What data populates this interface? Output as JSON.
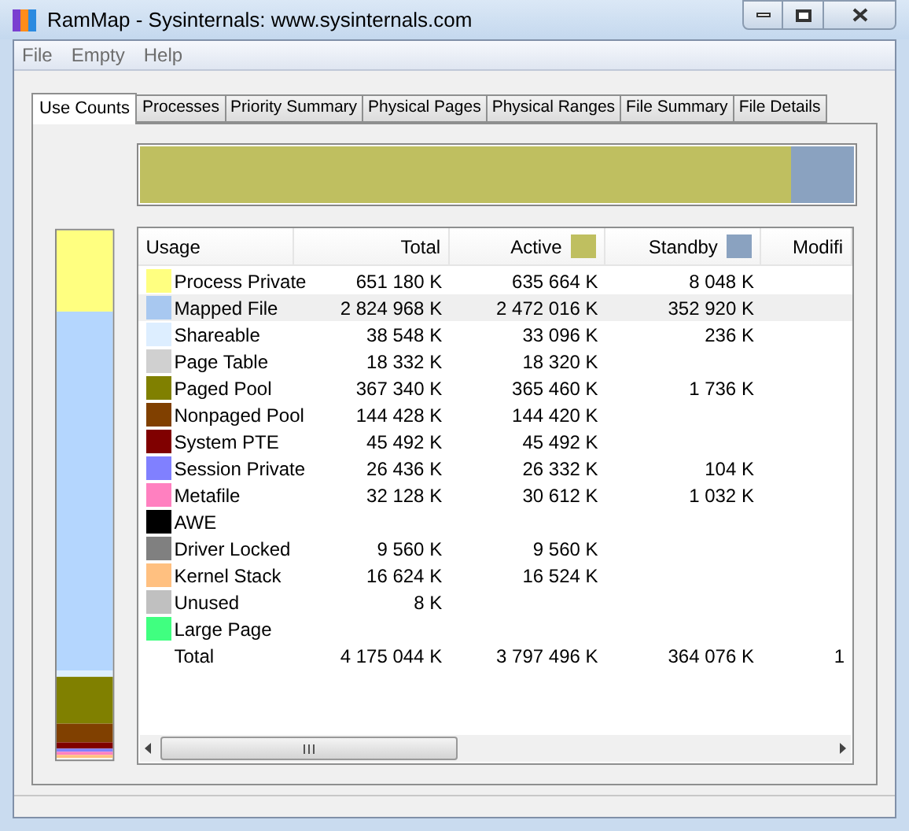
{
  "window": {
    "title": "RamMap - Sysinternals: www.sysinternals.com"
  },
  "menu": [
    "File",
    "Empty",
    "Help"
  ],
  "tabs": [
    {
      "label": "Use Counts",
      "selected": true
    },
    {
      "label": "Processes",
      "selected": false
    },
    {
      "label": "Priority Summary",
      "selected": false
    },
    {
      "label": "Physical Pages",
      "selected": false
    },
    {
      "label": "Physical Ranges",
      "selected": false
    },
    {
      "label": "File Summary",
      "selected": false
    },
    {
      "label": "File Details",
      "selected": false
    }
  ],
  "table": {
    "columns": [
      {
        "label": "Usage"
      },
      {
        "label": "Total"
      },
      {
        "label": "Active",
        "color": "#bfbf60"
      },
      {
        "label": "Standby",
        "color": "#8aa2c0"
      },
      {
        "label": "Modifi"
      }
    ],
    "rows": [
      {
        "kind": "usage",
        "color": "#ffff80",
        "selected": false,
        "cells": [
          "Process Private",
          "651 180 K",
          "635 664 K",
          "8 048 K",
          ""
        ]
      },
      {
        "kind": "usage",
        "color": "#a8c8f0",
        "selected": true,
        "cells": [
          "Mapped File",
          "2 824 968 K",
          "2 472 016 K",
          "352 920 K",
          ""
        ]
      },
      {
        "kind": "usage",
        "color": "#ddeeff",
        "selected": false,
        "cells": [
          "Shareable",
          "38 548 K",
          "33 096 K",
          "236 K",
          ""
        ]
      },
      {
        "kind": "usage",
        "color": "#d0d0d0",
        "selected": false,
        "cells": [
          "Page Table",
          "18 332 K",
          "18 320 K",
          "",
          ""
        ]
      },
      {
        "kind": "usage",
        "color": "#808000",
        "selected": false,
        "cells": [
          "Paged Pool",
          "367 340 K",
          "365 460 K",
          "1 736 K",
          ""
        ]
      },
      {
        "kind": "usage",
        "color": "#804000",
        "selected": false,
        "cells": [
          "Nonpaged Pool",
          "144 428 K",
          "144 420 K",
          "",
          ""
        ]
      },
      {
        "kind": "usage",
        "color": "#800000",
        "selected": false,
        "cells": [
          "System PTE",
          "45 492 K",
          "45 492 K",
          "",
          ""
        ]
      },
      {
        "kind": "usage",
        "color": "#8080ff",
        "selected": false,
        "cells": [
          "Session Private",
          "26 436 K",
          "26 332 K",
          "104 K",
          ""
        ]
      },
      {
        "kind": "usage",
        "color": "#ff80c0",
        "selected": false,
        "cells": [
          "Metafile",
          "32 128 K",
          "30 612 K",
          "1 032 K",
          ""
        ]
      },
      {
        "kind": "usage",
        "color": "#000000",
        "selected": false,
        "cells": [
          "AWE",
          "",
          "",
          "",
          ""
        ]
      },
      {
        "kind": "usage",
        "color": "#808080",
        "selected": false,
        "cells": [
          "Driver Locked",
          "9 560 K",
          "9 560 K",
          "",
          ""
        ]
      },
      {
        "kind": "usage",
        "color": "#ffc080",
        "selected": false,
        "cells": [
          "Kernel Stack",
          "16 624 K",
          "16 524 K",
          "",
          ""
        ]
      },
      {
        "kind": "usage",
        "color": "#c0c0c0",
        "selected": false,
        "cells": [
          "Unused",
          "8 K",
          "",
          "",
          ""
        ]
      },
      {
        "kind": "usage",
        "color": "#40ff80",
        "selected": false,
        "cells": [
          "Large Page",
          "",
          "",
          "",
          ""
        ]
      },
      {
        "kind": "total",
        "selected": false,
        "cells": [
          "Total",
          "4 175 044 K",
          "3 797 496 K",
          "364 076 K",
          "1"
        ]
      }
    ]
  }
}
